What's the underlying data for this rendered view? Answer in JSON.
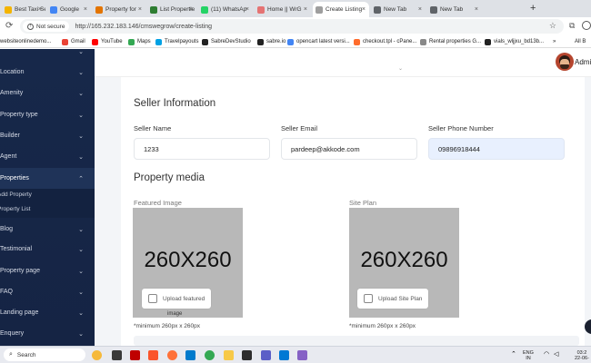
{
  "browser": {
    "tabs": [
      {
        "label": "Best Taxi Ser",
        "color": "#f4b400"
      },
      {
        "label": "Google",
        "color": "#4285f4"
      },
      {
        "label": "Property for",
        "color": "#e37400"
      },
      {
        "label": "List Propertie",
        "color": "#2e7d32"
      },
      {
        "label": "(11) WhatsAp",
        "color": "#25d366"
      },
      {
        "label": "Home || WrG",
        "color": "#e57373"
      },
      {
        "label": "Create Listing",
        "color": "#9e9e9e"
      },
      {
        "label": "New Tab",
        "color": "#5f6368"
      },
      {
        "label": "New Tab",
        "color": "#5f6368"
      }
    ],
    "new_tab_symbol": "+",
    "security_label": "Not secure",
    "url": "http://165.232.183.146/cmswegrow/create-listing",
    "bookmarks": [
      {
        "label": "websiteonlinedemo...",
        "color": "#2e7d32"
      },
      {
        "label": "Gmail",
        "color": "#ea4335"
      },
      {
        "label": "YouTube",
        "color": "#ff0000"
      },
      {
        "label": "Maps",
        "color": "#34a853"
      },
      {
        "label": "Travelpayouts",
        "color": "#00a1e4"
      },
      {
        "label": "SabreDevStudio",
        "color": "#222222"
      },
      {
        "label": "sabre.io",
        "color": "#222222"
      },
      {
        "label": "opencart latest versi...",
        "color": "#4285f4"
      },
      {
        "label": "checkout.tpl - cPane...",
        "color": "#ff6c2c"
      },
      {
        "label": "Rental properties G...",
        "color": "#888888"
      },
      {
        "label": "vials_wljjxu_bd13b...",
        "color": "#222222"
      }
    ],
    "bookmarks_more": "»",
    "all_bookmarks": "All B"
  },
  "sidebar": {
    "items": [
      {
        "label": "",
        "chevron": "⌄"
      },
      {
        "label": "Location",
        "chevron": "⌄"
      },
      {
        "label": "Amenity",
        "chevron": "⌄"
      },
      {
        "label": "Property type",
        "chevron": "⌄"
      },
      {
        "label": "Builder",
        "chevron": "⌄"
      },
      {
        "label": "Agent",
        "chevron": "⌄"
      },
      {
        "label": "Properties",
        "chevron": "⌃"
      },
      {
        "label": "Blog",
        "chevron": "⌄"
      },
      {
        "label": "Testimonial",
        "chevron": "⌄"
      },
      {
        "label": "Property page",
        "chevron": "⌄"
      },
      {
        "label": "FAQ",
        "chevron": "⌄"
      },
      {
        "label": "Landing page",
        "chevron": "⌄"
      },
      {
        "label": "Enquery",
        "chevron": "⌄"
      }
    ],
    "subitems": [
      "Add Property",
      "Property List"
    ]
  },
  "header": {
    "user_name": "Admi"
  },
  "seller": {
    "title": "Seller Information",
    "name_label": "Seller Name",
    "name_value": "1233",
    "email_label": "Seller Email",
    "email_value": "pardeep@akkode.com",
    "phone_label": "Seller Phone Number",
    "phone_value": "09896918444"
  },
  "media": {
    "title": "Property media",
    "featured_label": "Featured Image",
    "featured_placeholder": "260X260",
    "featured_upload": "Upload featured",
    "featured_upload_cont": "image",
    "siteplan_label": "Site Plan",
    "siteplan_placeholder": "260X260",
    "siteplan_upload": "Upload Site Plan",
    "min_note": "*minimum 260px x 260px"
  },
  "taskbar": {
    "search_label": "Search",
    "lang_top": "ENG",
    "lang_bottom": "IN",
    "time": "03:2",
    "date": "22-06-"
  }
}
